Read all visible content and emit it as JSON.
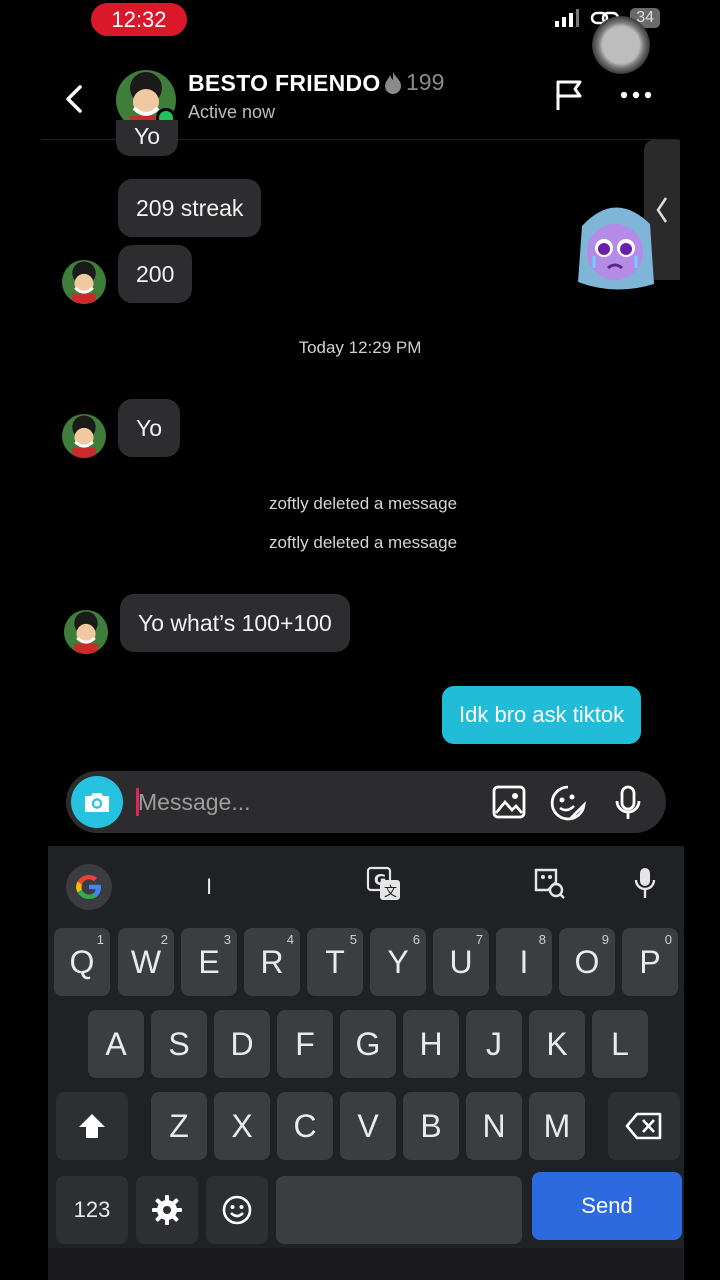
{
  "status_bar": {
    "time": "12:32",
    "battery": "34"
  },
  "header": {
    "contact_name": "BESTO FRIENDO",
    "streak_count": "199",
    "status": "Active now"
  },
  "chat": {
    "partial_message": "Yo",
    "messages_top": [
      {
        "text": "209 streak"
      },
      {
        "text": "200"
      }
    ],
    "timestamp": "Today 12:29 PM",
    "msg_yo": "Yo",
    "deleted_1": "zoftly deleted a message",
    "deleted_2": "zoftly deleted a message",
    "msg_question": "Yo what’s 100+100",
    "msg_reply": "Idk bro ask tiktok"
  },
  "composer": {
    "placeholder": "Message..."
  },
  "keyboard": {
    "suggestion": "I",
    "row1": [
      {
        "k": "Q",
        "n": "1"
      },
      {
        "k": "W",
        "n": "2"
      },
      {
        "k": "E",
        "n": "3"
      },
      {
        "k": "R",
        "n": "4"
      },
      {
        "k": "T",
        "n": "5"
      },
      {
        "k": "Y",
        "n": "6"
      },
      {
        "k": "U",
        "n": "7"
      },
      {
        "k": "I",
        "n": "8"
      },
      {
        "k": "O",
        "n": "9"
      },
      {
        "k": "P",
        "n": "0"
      }
    ],
    "row2": [
      "A",
      "S",
      "D",
      "F",
      "G",
      "H",
      "J",
      "K",
      "L"
    ],
    "row3": [
      "Z",
      "X",
      "C",
      "V",
      "B",
      "N",
      "M"
    ],
    "numbers_key": "123",
    "send_key": "Send"
  },
  "colors": {
    "outgoing": "#21bcd8",
    "incoming": "#2d2d2f",
    "send": "#2d6ae0",
    "time_pill": "#d9182a"
  }
}
